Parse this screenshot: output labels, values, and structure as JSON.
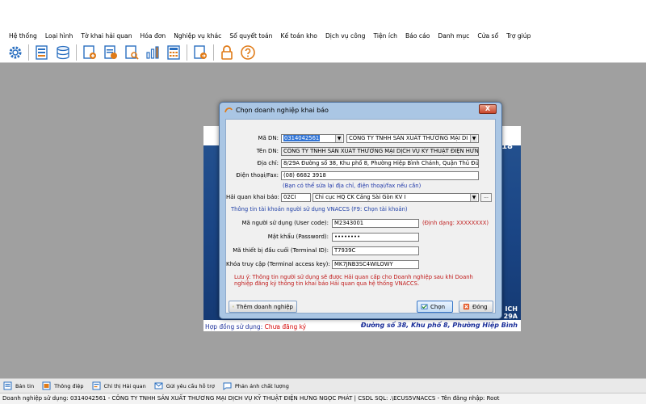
{
  "menu": [
    "Hệ thống",
    "Loại hình",
    "Tờ khai hải quan",
    "Hóa đơn",
    "Nghiệp vụ khác",
    "Sổ quyết toán",
    "Kế toán kho",
    "Dịch vụ công",
    "Tiện ích",
    "Báo cáo",
    "Danh mục",
    "Cửa sổ",
    "Trợ giúp"
  ],
  "background_image": {
    "corner_number": "18",
    "right_text_1": "ICH",
    "right_text_2": "29A",
    "contract_label": "Hợp đồng sử dụng:",
    "contract_status": "Chưa đăng ký",
    "address": "Đường số 38, Khu phố 8, Phường Hiệp Bình"
  },
  "dialog": {
    "title": "Chọn doanh nghiệp khai báo",
    "close_label": "X",
    "fields": {
      "ma_dn_label": "Mã DN:",
      "ma_dn_value": "0314042561",
      "ma_dn_select": "CÔNG TY TNHH SẢN XUẤT THƯƠNG MẠI DI",
      "ten_dn_label": "Tên DN:",
      "ten_dn_value": "CÔNG TY TNHH SẢN XUẤT THƯƠNG MẠI DỊCH VỤ KỸ THUẬT ĐIỆN HƯN",
      "dia_chi_label": "Địa chỉ:",
      "dia_chi_value": "8/29A Đường số 38, Khu phố 8, Phường Hiệp Bình Chánh, Quận Thủ Đức, Th",
      "phone_label": "Điện thoại/Fax:",
      "phone_value": "(08) 6682 3918",
      "phone_hint": "(Bạn có thể sửa lại địa chỉ, điện thoại/fax nếu cần)",
      "hq_label": "Hải quan khai báo:",
      "hq_code": "02CI",
      "hq_name": "Chi cục HQ CK Cảng Sài Gòn KV I",
      "ellipsis": "...",
      "vnaccs_section": "Thông tin tài khoản người sử dụng VNACCS (F9: Chọn tài khoản)",
      "user_code_label": "Mã người sử dụng (User code):",
      "user_code_value": "M2343001",
      "user_code_hint": "(Định dạng: XXXXXXXX)",
      "password_label": "Mật khẩu (Password):",
      "password_value": "••••••••",
      "terminal_id_label": "Mã thiết bị đầu cuối (Terminal ID):",
      "terminal_id_value": "T7939C",
      "access_key_label": "Khóa truy cập (Terminal access key):",
      "access_key_value": "MK7JNB3SC4WILOWY",
      "note": "Lưu ý: Thông tin người sử dụng sẽ được Hải quan cấp cho Doanh nghiệp sau khi Doanh nghiệp đăng ký thông tin khai báo Hải quan qua hệ thống VNACCS."
    },
    "buttons": {
      "add_company": "Thêm doanh nghiệp",
      "select": "Chọn",
      "close": "Đóng"
    }
  },
  "taskbar": [
    "Bản tin",
    "Thông điệp",
    "Chỉ thị Hải quan",
    "Gửi yêu cầu hỗ trợ",
    "Phản ánh chất lượng"
  ],
  "status": "Doanh nghiệp sử dụng: 0314042561 - CÔNG TY TNHH SẢN XUẤT THƯƠNG MẠI DỊCH VỤ KỸ THUẬT ĐIỆN HƯNG NGỌC PHÁT  |  CSDL SQL: .\\ECUS5VNACCS - Tên đăng nhập: Root"
}
